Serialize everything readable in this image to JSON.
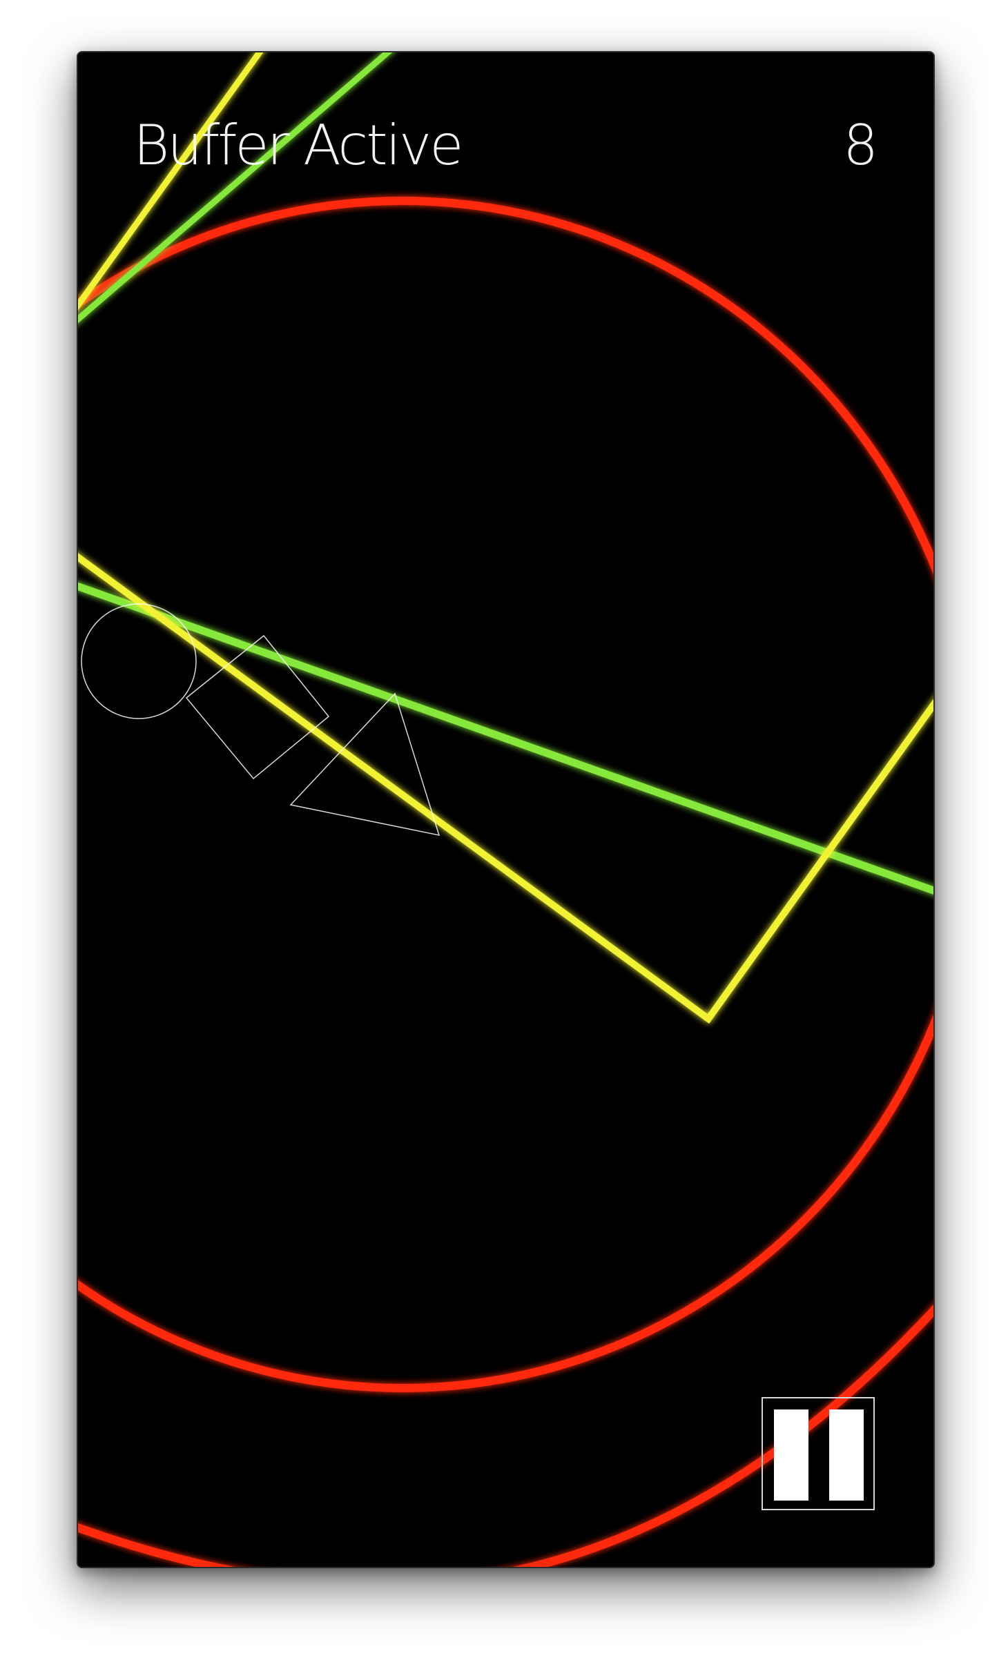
{
  "hud": {
    "status": "Buffer Active",
    "score": "8"
  },
  "colors": {
    "background": "#000000",
    "red_ring": "#ff2a10",
    "yellow_beam": "#f2f236",
    "green_beam": "#86e83a",
    "outline_white": "#ffffff"
  },
  "icons": {
    "pause": "pause-icon"
  }
}
